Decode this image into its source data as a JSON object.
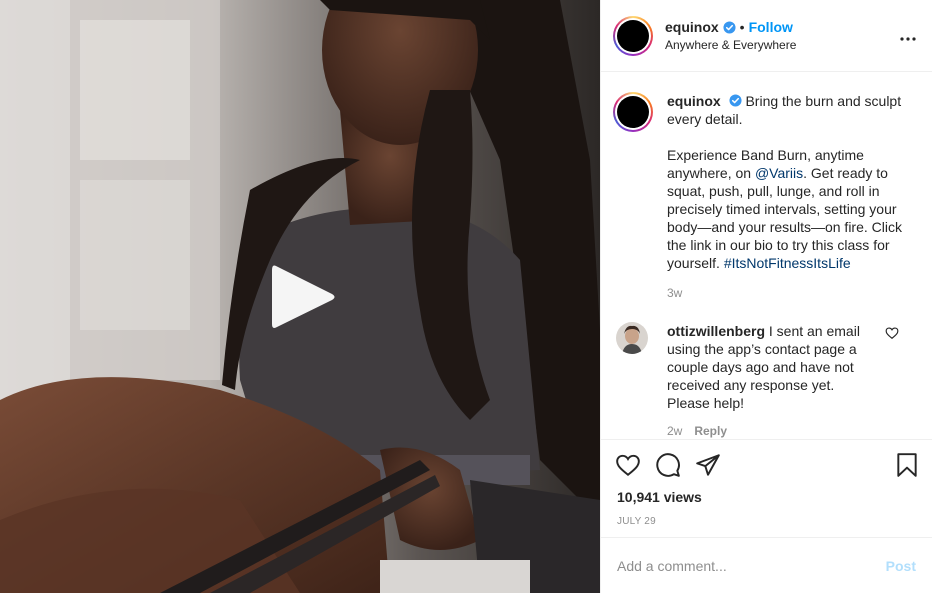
{
  "account": {
    "username": "equinox",
    "verified": true,
    "separator": "•",
    "follow_label": "Follow",
    "location": "Anywhere & Everywhere",
    "more_icon": "more-options-icon",
    "avatar_ring_colors": [
      "#feda75",
      "#fa7e1e",
      "#d62976",
      "#962fbf",
      "#4f5bd5"
    ]
  },
  "caption": {
    "username": "equinox",
    "line1": "Bring the burn and sculpt every detail.",
    "line2_pre": "Experience Band Burn, anytime anywhere, on ",
    "mention": "@Variis",
    "line2_post": ". Get ready to squat, push, pull, lunge, and roll in precisely timed intervals, setting your body—and your results—on fire. Click the link in our bio to try this class for yourself. ",
    "hashtag": "#ItsNotFitnessItsLife",
    "time": "3w"
  },
  "comments": [
    {
      "username": "ottizwillenberg",
      "text": "I sent an email using the app’s contact page a couple days ago and have not received any response yet. Please help!",
      "time": "2w",
      "reply_label": "Reply"
    }
  ],
  "actions": {
    "icons": [
      "heart-icon",
      "comment-icon",
      "share-icon",
      "bookmark-icon"
    ]
  },
  "stats": {
    "views": "10,941 views",
    "date": "JULY 29"
  },
  "add_comment": {
    "placeholder": "Add a comment...",
    "post_label": "Post"
  },
  "colors": {
    "link_blue": "#0095f6",
    "mention_blue": "#00376b",
    "muted": "#8e8e8e",
    "post_disabled": "#b2dffc",
    "verified_blue": "#3897f0"
  }
}
